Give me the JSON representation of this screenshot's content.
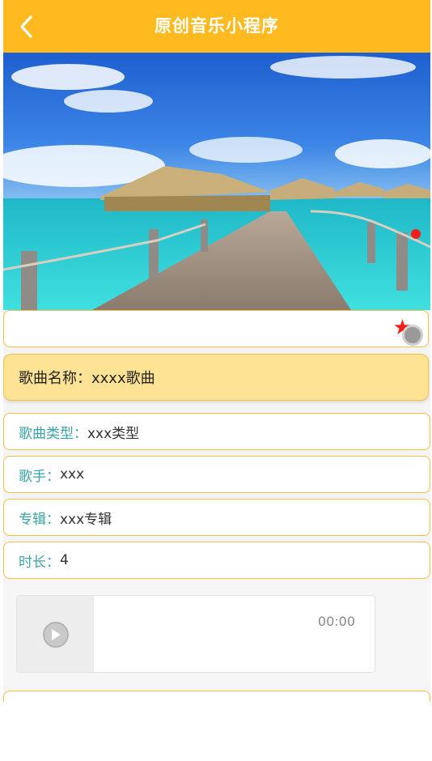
{
  "header": {
    "title": "原创音乐小程序",
    "back_icon": "chevron-left-icon"
  },
  "colors": {
    "header_bg": "#ffba1f",
    "accent_border": "#f0c248",
    "label_teal": "#3aa4a4",
    "name_card_bg": "#ffe394",
    "carousel_dot": "#ff1a1a"
  },
  "banner": {
    "image": "beach-pier-photo"
  },
  "favorite": {
    "icon": "star-icon"
  },
  "song": {
    "name_label": "歌曲名称：",
    "name_value": "xxxx歌曲"
  },
  "fields": [
    {
      "label": "歌曲类型：",
      "value": "xxx类型"
    },
    {
      "label": "歌手：",
      "value": "xxx"
    },
    {
      "label": "专辑：",
      "value": "xxx专辑"
    },
    {
      "label": "时长：",
      "value": "4"
    }
  ],
  "player": {
    "time": "00:00",
    "play_icon": "play-icon"
  }
}
